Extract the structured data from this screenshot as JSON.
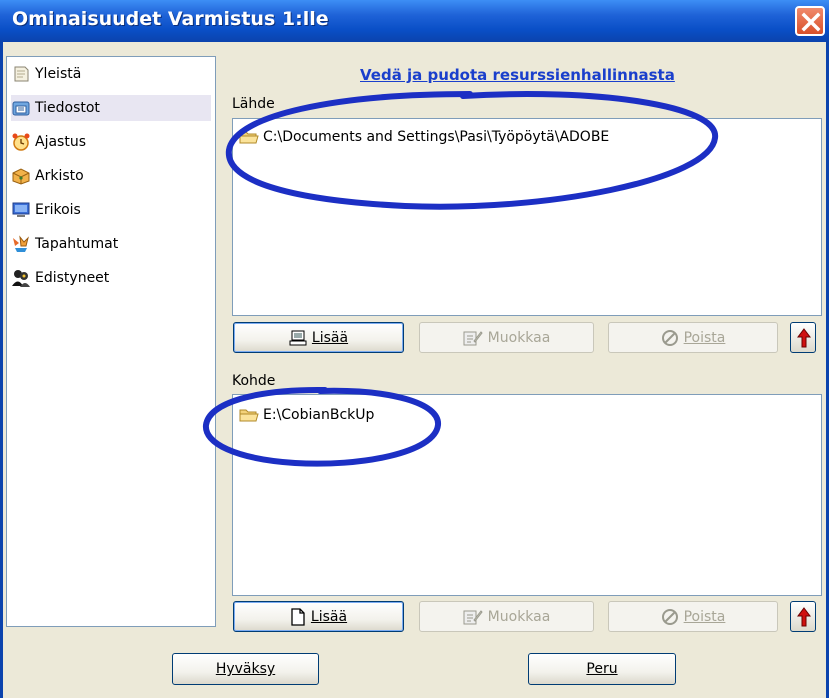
{
  "window": {
    "title": "Ominaisuudet Varmistus 1:lle"
  },
  "sidebar": {
    "items": [
      {
        "label": "Yleistä",
        "icon": "document-icon"
      },
      {
        "label": "Tiedostot",
        "icon": "files-icon",
        "selected": true
      },
      {
        "label": "Ajastus",
        "icon": "alarm-clock-icon"
      },
      {
        "label": "Arkisto",
        "icon": "archive-box-icon"
      },
      {
        "label": "Erikois",
        "icon": "monitor-icon"
      },
      {
        "label": "Tapahtumat",
        "icon": "events-icon"
      },
      {
        "label": "Edistyneet",
        "icon": "advanced-users-icon"
      }
    ]
  },
  "main": {
    "dragdrop_link": "Vedä ja pudota resurssienhallinnasta",
    "source": {
      "label": "Lähde",
      "entries": [
        "C:\\Documents and Settings\\Pasi\\Työpöytä\\ADOBE"
      ],
      "add_label": "Lisää",
      "edit_label": "Muokkaa",
      "remove_label": "Poista"
    },
    "destination": {
      "label": "Kohde",
      "entries": [
        "E:\\CobianBckUp"
      ],
      "add_label": "Lisää",
      "edit_label": "Muokkaa",
      "remove_label": "Poista"
    }
  },
  "footer": {
    "ok_label": "Hyväksy",
    "cancel_label": "Peru"
  },
  "colors": {
    "titlebar": "#0a4fc7",
    "annotation": "#1c2fc4",
    "link": "#1a3fcc",
    "up_arrow": "#d01010"
  }
}
